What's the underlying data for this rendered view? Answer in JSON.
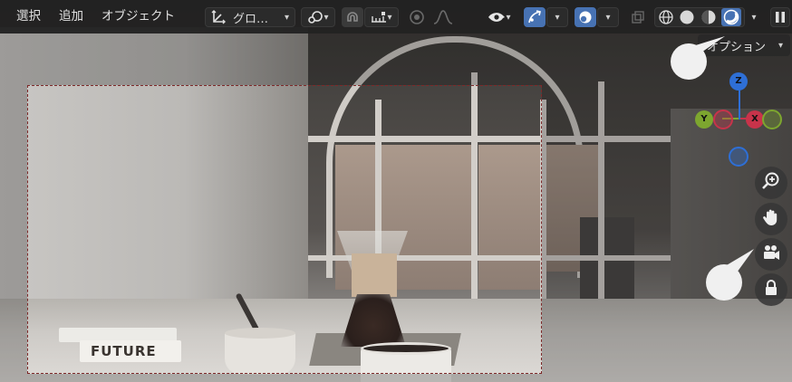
{
  "menu": {
    "select": "選択",
    "add": "追加",
    "object": "オブジェクト"
  },
  "toolbar": {
    "transform_orientation": "グロ…"
  },
  "options_dropdown": {
    "label": "オプション"
  },
  "gizmo": {
    "z": "Z",
    "y": "Y",
    "x": "X",
    "colors": {
      "x": "#c8334a",
      "y": "#7da62f",
      "z": "#2e6fd6"
    }
  },
  "scene": {
    "book_title": "FUTURE"
  },
  "icons": {
    "nav": [
      "zoom-icon",
      "pan-hand-icon",
      "camera-icon",
      "lock-icon"
    ]
  },
  "colors": {
    "accent": "#4772b3",
    "header": "#222222"
  }
}
